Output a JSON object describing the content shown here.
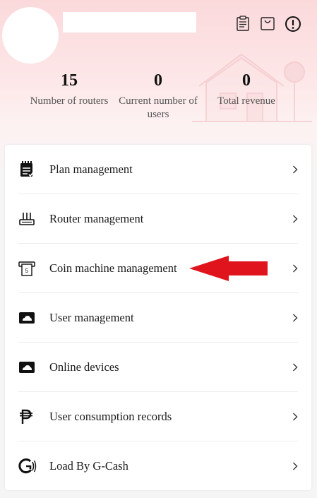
{
  "stats": [
    {
      "value": "15",
      "label": "Number of routers"
    },
    {
      "value": "0",
      "label": "Current number of users"
    },
    {
      "value": "0",
      "label": "Total revenue"
    }
  ],
  "menu": [
    {
      "label": "Plan management",
      "icon": "plan-icon"
    },
    {
      "label": "Router management",
      "icon": "router-icon"
    },
    {
      "label": "Coin machine management",
      "icon": "coin-machine-icon"
    },
    {
      "label": "User management",
      "icon": "user-management-icon"
    },
    {
      "label": "Online devices",
      "icon": "online-devices-icon"
    },
    {
      "label": "User consumption records",
      "icon": "peso-icon"
    },
    {
      "label": "Load By G-Cash",
      "icon": "gcash-icon"
    }
  ],
  "top_icons": [
    "clipboard-icon",
    "shopping-bag-icon",
    "alert-icon"
  ],
  "colors": {
    "header_gradient_top": "#fbd9db",
    "arrow_red": "#e0141c",
    "text": "#1a1a1a"
  }
}
